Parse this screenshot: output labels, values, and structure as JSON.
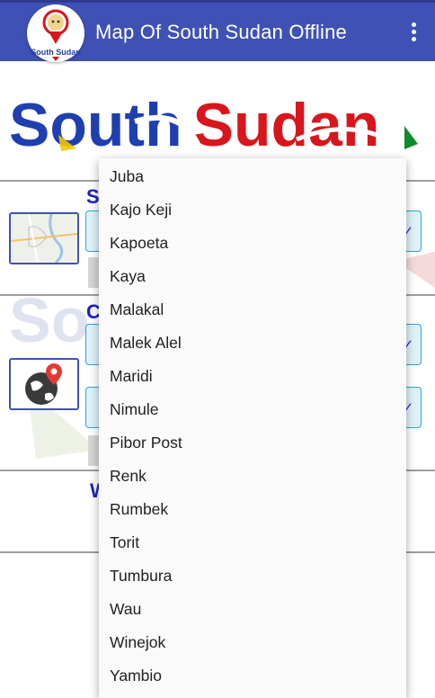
{
  "app_bar": {
    "title": "Map Of South Sudan Offline",
    "logo_text": "South Sudan",
    "menu_icon": "overflow-menu-icon"
  },
  "banner": {
    "text_part1": "South",
    "text_part2": "Sudan",
    "colors": {
      "blue": "#1f3fb0",
      "red": "#d8161c",
      "green": "#0f8a2b",
      "yellow": "#f2c500"
    }
  },
  "sections": [
    {
      "letter": "S",
      "icon": "map-thumbnail-icon"
    },
    {
      "letter": "C",
      "icon": "globe-location-icon"
    },
    {
      "letter": "W"
    }
  ],
  "dropdown": {
    "items": [
      "Juba",
      "Kajo Keji",
      "Kapoeta",
      "Kaya",
      "Malakal",
      "Malek Alel",
      "Maridi",
      "Nimule",
      "Pibor Post",
      "Renk",
      "Rumbek",
      "Torit",
      "Tumbura",
      "Wau",
      "Winejok",
      "Yambio"
    ]
  },
  "colors": {
    "appbar": "#3f51b5",
    "accent_text": "#1a23c9",
    "select_border": "#29a7d6"
  }
}
